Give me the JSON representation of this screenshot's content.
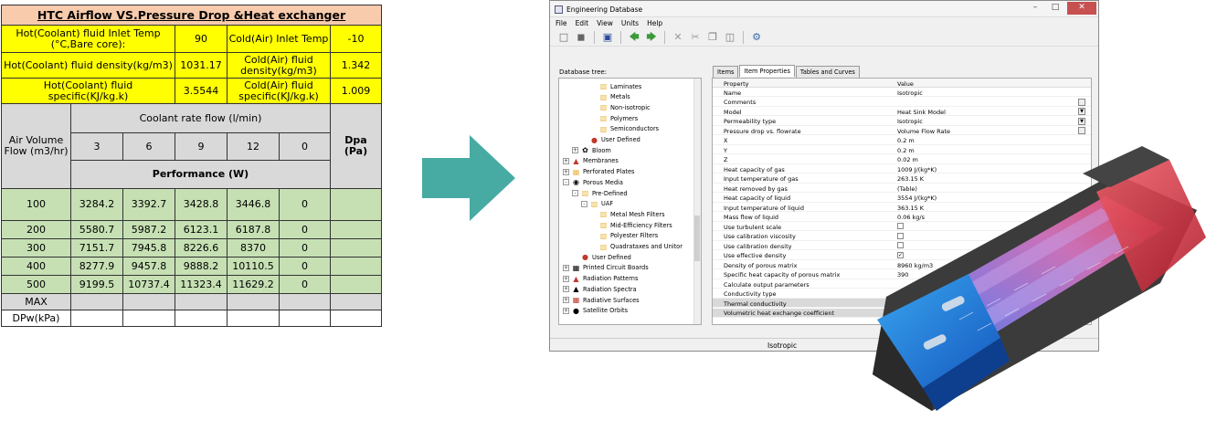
{
  "table": {
    "title": "HTC Airflow VS.Pressure Drop &Heat exchanger",
    "hot_inlet_label": "Hot(Coolant) fluid Inlet Temp (°C,Bare core):",
    "hot_inlet_value": "90",
    "cold_inlet_label": "Cold(Air) Inlet Temp",
    "cold_inlet_value": "-10",
    "hot_density_label": "Hot(Coolant) fluid density(kg/m3)",
    "hot_density_value": "1031.17",
    "cold_density_label": "Cold(Air) fluid density(kg/m3)",
    "cold_density_value": "1.342",
    "hot_specific_label": "Hot(Coolant) fluid specific(KJ/kg.k)",
    "hot_specific_value": "3.5544",
    "cold_specific_label": "Cold(Air) fluid specific(KJ/kg.k)",
    "cold_specific_value": "1.009",
    "air_volume_label": "Air Volume Flow (m3/hr)",
    "coolant_rate_label": "Coolant rate flow (l/min)",
    "dpa_label": "Dpa (Pa)",
    "flow_columns": [
      "3",
      "6",
      "9",
      "12",
      "0"
    ],
    "performance_label": "Performance (W)",
    "rows": [
      {
        "air": "100",
        "values": [
          "3284.2",
          "3392.7",
          "3428.8",
          "3446.8",
          "0"
        ]
      },
      {
        "air": "200",
        "values": [
          "5580.7",
          "5987.2",
          "6123.1",
          "6187.8",
          "0"
        ]
      },
      {
        "air": "300",
        "values": [
          "7151.7",
          "7945.8",
          "8226.6",
          "8370",
          "0"
        ]
      },
      {
        "air": "400",
        "values": [
          "8277.9",
          "9457.8",
          "9888.2",
          "10110.5",
          "0"
        ]
      },
      {
        "air": "500",
        "values": [
          "9199.5",
          "10737.4",
          "11323.4",
          "11629.2",
          "0"
        ]
      }
    ],
    "max_label": "MAX",
    "dpw_label": "DPw(kPa)"
  },
  "window": {
    "title": "Engineering Database",
    "menu": [
      "File",
      "Edit",
      "View",
      "Units",
      "Help"
    ],
    "tree_label": "Database tree:",
    "tree": [
      {
        "label": "Laminates",
        "icon": "folder-icon",
        "level": 3
      },
      {
        "label": "Metals",
        "icon": "folder-icon",
        "level": 3
      },
      {
        "label": "Non-isotropic",
        "icon": "folder-icon",
        "level": 3
      },
      {
        "label": "Polymers",
        "icon": "folder-icon",
        "level": 3
      },
      {
        "label": "Semiconductors",
        "icon": "folder-icon",
        "level": 3
      },
      {
        "label": "User Defined",
        "icon": "user-folder-icon",
        "level": 2
      },
      {
        "label": "Bloom",
        "icon": "bloom-icon",
        "level": 1,
        "exp": "+"
      },
      {
        "label": "Membranes",
        "icon": "membrane-icon",
        "level": 0,
        "exp": "+"
      },
      {
        "label": "Perforated Plates",
        "icon": "plate-icon",
        "level": 0,
        "exp": "+"
      },
      {
        "label": "Porous Media",
        "icon": "porous-icon",
        "level": 0,
        "exp": "-"
      },
      {
        "label": "Pre-Defined",
        "icon": "folder-icon",
        "level": 1,
        "exp": "-"
      },
      {
        "label": "UAF",
        "icon": "folder-icon",
        "level": 2,
        "exp": "-"
      },
      {
        "label": "Metal Mesh Filters",
        "icon": "folder-icon",
        "level": 3
      },
      {
        "label": "Mid-Efficiency Filters",
        "icon": "folder-icon",
        "level": 3
      },
      {
        "label": "Polyester Filters",
        "icon": "folder-icon",
        "level": 3
      },
      {
        "label": "Quadrataxes and Unitor",
        "icon": "folder-icon",
        "level": 3
      },
      {
        "label": "User Defined",
        "icon": "user-folder-icon",
        "level": 1
      },
      {
        "label": "Printed Circuit Boards",
        "icon": "pcb-icon",
        "level": 0,
        "exp": "+"
      },
      {
        "label": "Radiation Patterns",
        "icon": "radiation-icon",
        "level": 0,
        "exp": "+"
      },
      {
        "label": "Radiation Spectra",
        "icon": "spectra-icon",
        "level": 0,
        "exp": "+"
      },
      {
        "label": "Radiative Surfaces",
        "icon": "surface-icon",
        "level": 0,
        "exp": "+"
      },
      {
        "label": "Satellite Orbits",
        "icon": "satellite-icon",
        "level": 0,
        "exp": "+"
      }
    ],
    "tabs": [
      "Items",
      "Item Properties",
      "Tables and Curves"
    ],
    "grid_headers": {
      "property": "Property",
      "value": "Value"
    },
    "properties": [
      {
        "p": "Name",
        "v": "Isotropic"
      },
      {
        "p": "Comments",
        "v": "",
        "btn": true
      },
      {
        "p": "Model",
        "v": "Heat Sink Model",
        "dd": true
      },
      {
        "p": "Permeability type",
        "v": "Isotropic",
        "dd": true
      },
      {
        "p": "Pressure drop vs. flowrate",
        "v": "Volume Flow Rate",
        "btn": true
      },
      {
        "p": "X",
        "v": "0.2 m"
      },
      {
        "p": "Y",
        "v": "0.2 m"
      },
      {
        "p": "Z",
        "v": "0.02 m"
      },
      {
        "p": "Heat capacity of gas",
        "v": "1009 J/(kg*K)"
      },
      {
        "p": "Input temperature of gas",
        "v": "263.15 K"
      },
      {
        "p": "Heat removed by gas",
        "v": "(Table)"
      },
      {
        "p": "Heat capacity of liquid",
        "v": "3554 J/(kg*K)"
      },
      {
        "p": "Input temperature of liquid",
        "v": "363.15 K"
      },
      {
        "p": "Mass flow of liquid",
        "v": "0.06 kg/s"
      },
      {
        "p": "Use turbulent scale",
        "v": "",
        "chk": "unchecked"
      },
      {
        "p": "Use calibration viscosity",
        "v": "",
        "chk": "unchecked"
      },
      {
        "p": "Use calibration density",
        "v": "",
        "chk": "unchecked"
      },
      {
        "p": "Use effective density",
        "v": "",
        "chk": "checked"
      },
      {
        "p": "Density of porous matrix",
        "v": "8960 kg/m3"
      },
      {
        "p": "Specific heat capacity of porous matrix",
        "v": "390"
      },
      {
        "p": "Calculate output parameters",
        "v": ""
      },
      {
        "p": "Conductivity type",
        "v": ""
      },
      {
        "p": "Thermal conductivity",
        "v": "",
        "dark": true
      },
      {
        "p": "Volumetric heat exchange coefficient",
        "v": "",
        "dark": true
      }
    ],
    "status": "Isotropic"
  },
  "colors": {
    "arrow": "#47aba4",
    "title_bg": "#f8cbad",
    "yellow": "#ffff00",
    "gray": "#d9d9d9",
    "green": "#c6e0b4"
  }
}
